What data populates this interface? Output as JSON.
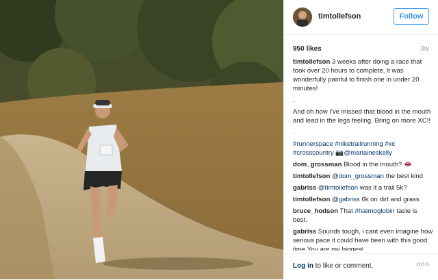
{
  "header": {
    "username": "timtollefson",
    "follow_label": "Follow"
  },
  "meta": {
    "likes": "950 likes",
    "age": "3w"
  },
  "caption": {
    "user": "timtollefson",
    "line1": "3 weeks after doing a race that took over 20 hours to complete, it was wonderfully painful to finish one in under 20 minutes!",
    "dot1": ".",
    "line2": "And oh how I've missed that blood in the mouth and lead in the legs feeling. Bring on more XC!!",
    "dot2": ".",
    "tag1": "#runnerspace",
    "tag2": "#niketrailrunning",
    "tag3": "#xc",
    "tag4": "#crosscountry",
    "emoji": "📷",
    "mention": "@mariaineskelly"
  },
  "comments": [
    {
      "user": "dom_grossman",
      "text": "Blood in the mouth? 👄",
      "mention": ""
    },
    {
      "user": "timtollefson",
      "mention": "@dom_grossman",
      "text": " the best kind"
    },
    {
      "user": "gabriss",
      "mention": "@timtollefson",
      "text": " was it a trail 5k?"
    },
    {
      "user": "timtollefson",
      "mention": "@gabriss",
      "text": " 6k on dirt and grass"
    },
    {
      "user": "bruce_hodson",
      "text": "That ",
      "mention": "#hæmoglobin",
      "text2": " taste is best."
    },
    {
      "user": "gabriss",
      "text": "Sounds tough, i cant even imagine how serious pace it could have been with this good time.You are my biggest",
      "mention": ""
    }
  ],
  "footer": {
    "login_link": "Log in",
    "login_text": " to like or comment.",
    "more": "ooo"
  }
}
